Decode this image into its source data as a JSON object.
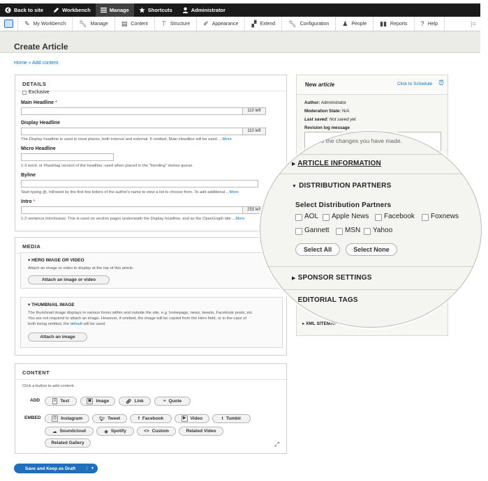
{
  "topbar": {
    "items": [
      {
        "label": "Back to site",
        "icon": "back-circle-icon"
      },
      {
        "label": "Workbench",
        "icon": "pen-icon"
      },
      {
        "label": "Manage",
        "icon": "hamburger-icon"
      },
      {
        "label": "Shortcuts",
        "icon": "star-icon"
      },
      {
        "label": "Administrator",
        "icon": "user-icon"
      }
    ]
  },
  "toolbar": {
    "items": [
      {
        "label": "My Workbench",
        "icon": "pen-icon"
      },
      {
        "label": "Manage",
        "icon": "wrench-icon"
      },
      {
        "label": "Content",
        "icon": "document-icon"
      },
      {
        "label": "Structure",
        "icon": "sitemap-icon"
      },
      {
        "label": "Appearance",
        "icon": "brush-icon"
      },
      {
        "label": "Extend",
        "icon": "puzzle-icon"
      },
      {
        "label": "Configuration",
        "icon": "wrench-icon"
      },
      {
        "label": "People",
        "icon": "people-icon"
      },
      {
        "label": "Reports",
        "icon": "bar-chart-icon"
      },
      {
        "label": "Help",
        "icon": "help-icon"
      }
    ]
  },
  "page": {
    "title": "Create Article",
    "breadcrumb_home": "Home",
    "breadcrumb_sep": "»",
    "breadcrumb_current": "Add content"
  },
  "details": {
    "title": "DETAILS",
    "exclusive": "Exclusive",
    "main_headline": "Main Headline",
    "main_headline_counter": "110 left",
    "display_headline": "Display Headline",
    "display_headline_counter": "110 left",
    "display_desc": "The Display headline is used in most places, both internal and external. If omitted, Main Headline will be used. ...",
    "more": "More",
    "micro_headline": "Micro Headline",
    "micro_desc": "1-3 word, or #hashtag version of the headline; used when placed in the \"trending\" stories queue.",
    "byline": "Byline",
    "byline_desc": "Start typing @, followed by the first few letters of the author's name to view a list to choose from. To add additional ...",
    "intro": "Intro",
    "intro_counter": "255 left",
    "intro_desc": "1-2 sentence intro/teaser. This is used on section pages underneath the Display headline, and as the OpenGraph title ...",
    "required_mark": "*"
  },
  "media": {
    "title": "MEDIA",
    "hero_title": "HERO IMAGE OR VIDEO",
    "hero_desc": "Attach an image or video to display at the top of this article.",
    "hero_button": "Attach an image or video",
    "thumb_title": "THUMBNAIL IMAGE",
    "thumb_desc_1": "The thumbnail image displays in various forms within and outside the site, e.g. homepage, news, tweets, Facebook posts, etc.",
    "thumb_desc_2": "You are not required to attach an image. However, if omitted, the image will be copied from the Hero field, or in the case of",
    "thumb_desc_3a": "both being omitted, the",
    "thumb_desc_3b": "default",
    "thumb_desc_3c": "will be used.",
    "thumb_button": "Attach an image"
  },
  "content": {
    "title": "CONTENT",
    "hint": "Click a button to add content.",
    "add_label": "ADD",
    "embed_label": "EMBED",
    "add_buttons": [
      "Text",
      "Image",
      "Link",
      "Quote"
    ],
    "embed_buttons": [
      "Instagram",
      "Tweet",
      "Facebook",
      "Video",
      "Tumblr",
      "Soundcloud",
      "Spotify",
      "Custom",
      "Related Video",
      "Related Gallery"
    ]
  },
  "actions": {
    "save_label": "Save and Keep as Draft"
  },
  "sidebar": {
    "new_label": "New",
    "new_type": "article",
    "schedule_link": "Click to Schedule",
    "author_label": "Author:",
    "author_value": "Administrator",
    "moderation_label": "Moderation State:",
    "moderation_value": "N/A",
    "last_saved_label": "Last saved:",
    "last_saved_value": "Not saved yet",
    "revision_label": "Revision log message",
    "revision_placeholder": "Describe the changes you have made.",
    "xml_sitemap": "XML SITEMAP"
  },
  "lens": {
    "revision_placeholder_partial": "cribe the changes you have made.",
    "article_info": "ARTICLE INFORMATION",
    "distribution": "DISTRIBUTION PARTNERS",
    "select_label": "Select Distribution Partners",
    "partners": [
      "AOL",
      "Apple News",
      "Facebook",
      "Foxnews",
      "Gannett",
      "MSN",
      "Yahoo"
    ],
    "select_all": "Select All",
    "select_none": "Select None",
    "sponsor": "SPONSOR SETTINGS",
    "editorial": "EDITORIAL TAGS"
  }
}
